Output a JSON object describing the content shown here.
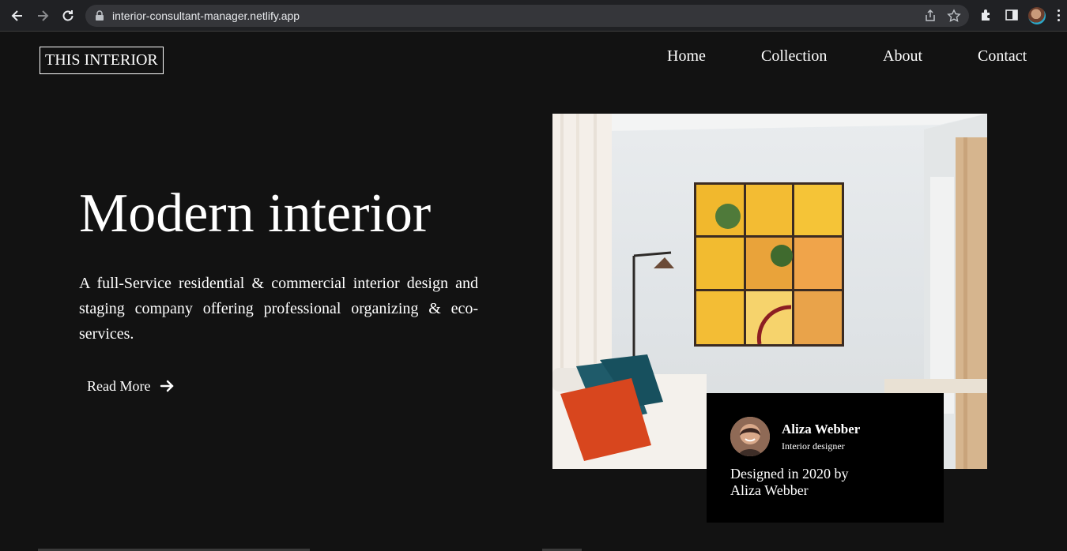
{
  "browser": {
    "url": "interior-consultant-manager.netlify.app"
  },
  "site": {
    "logo": "THIS INTERIOR",
    "nav": {
      "home": "Home",
      "collection": "Collection",
      "about": "About",
      "contact": "Contact"
    }
  },
  "hero": {
    "title": "Modern interior",
    "description": "A full-Service residential & commercial interior design and staging company offering professional organizing & eco-services.",
    "read_more": "Read More"
  },
  "card": {
    "name": "Aliza Webber",
    "role": "Interior designer",
    "credit": "Designed in 2020 by Aliza Webber"
  },
  "colors": {
    "background": "#121212",
    "card": "#000000",
    "text": "#ffffff",
    "accent_yellow": "#f1b82d",
    "accent_orange": "#d8461e",
    "accent_teal": "#1d5c6b"
  }
}
